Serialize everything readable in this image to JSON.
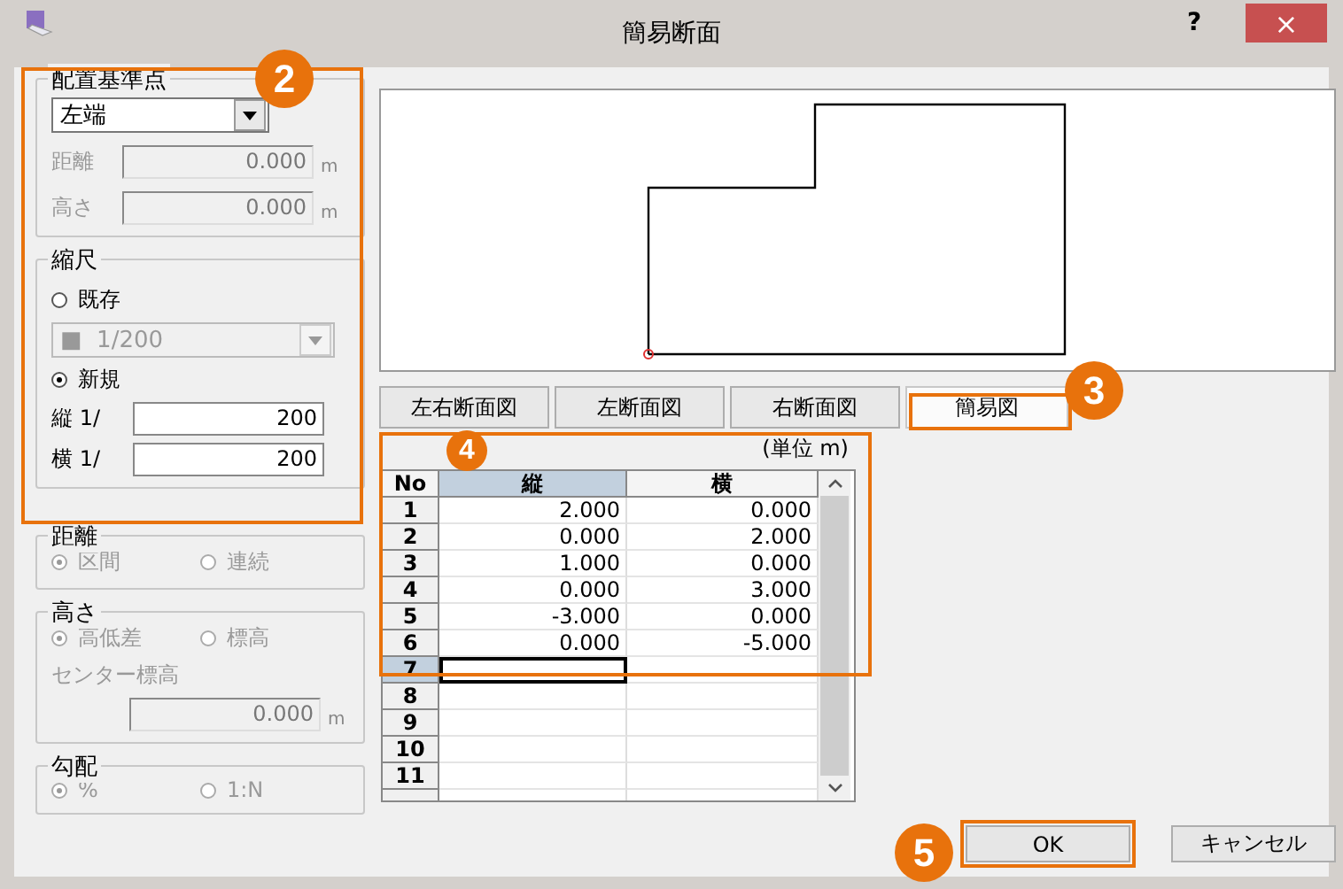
{
  "window": {
    "title": "簡易断面",
    "help": "?",
    "close": "×"
  },
  "placement": {
    "legend": "配置基準点",
    "dropdown": "左端",
    "fields": [
      {
        "label": "距離",
        "value": "0.000",
        "unit": "m",
        "disabled": true
      },
      {
        "label": "高さ",
        "value": "0.000",
        "unit": "m",
        "disabled": true
      }
    ]
  },
  "scale": {
    "legend": "縮尺",
    "options": [
      {
        "label": "既存",
        "selected": false
      },
      {
        "label": "新規",
        "selected": true
      }
    ],
    "dropdown": {
      "swatch": "■",
      "value": "1/200",
      "disabled": true
    },
    "fields": [
      {
        "label": "縦 1/",
        "value": "200"
      },
      {
        "label": "横 1/",
        "value": "200"
      }
    ]
  },
  "distance": {
    "legend": "距離",
    "disabled": true,
    "options": [
      {
        "label": "区間",
        "selected": true
      },
      {
        "label": "連続",
        "selected": false
      }
    ]
  },
  "height": {
    "legend": "高さ",
    "disabled": true,
    "options": [
      {
        "label": "高低差",
        "selected": true
      },
      {
        "label": "標高",
        "selected": false
      }
    ],
    "center_label": "センター標高",
    "center_value": "0.000",
    "unit": "m"
  },
  "slope": {
    "legend": "勾配",
    "disabled": true,
    "options": [
      {
        "label": "%",
        "selected": true
      },
      {
        "label": "1:N",
        "selected": false
      }
    ]
  },
  "view_tabs": [
    {
      "label": "左右断面図",
      "selected": false
    },
    {
      "label": "左断面図",
      "selected": false
    },
    {
      "label": "右断面図",
      "selected": false
    },
    {
      "label": "簡易図",
      "selected": true
    }
  ],
  "table": {
    "unit_label": "(単位 m)",
    "columns": [
      {
        "label": "No",
        "selected": false
      },
      {
        "label": "縦",
        "selected": true
      },
      {
        "label": "横",
        "selected": false
      }
    ],
    "rows": [
      {
        "no": "1",
        "vertical": "2.000",
        "horizontal": "0.000",
        "selected": false
      },
      {
        "no": "2",
        "vertical": "0.000",
        "horizontal": "2.000",
        "selected": false
      },
      {
        "no": "3",
        "vertical": "1.000",
        "horizontal": "0.000",
        "selected": false
      },
      {
        "no": "4",
        "vertical": "0.000",
        "horizontal": "3.000",
        "selected": false
      },
      {
        "no": "5",
        "vertical": "-3.000",
        "horizontal": "0.000",
        "selected": false
      },
      {
        "no": "6",
        "vertical": "0.000",
        "horizontal": "-5.000",
        "selected": false
      },
      {
        "no": "7",
        "selected": true
      },
      {
        "no": "8",
        "selected": false
      },
      {
        "no": "9",
        "selected": false
      },
      {
        "no": "10",
        "selected": false
      },
      {
        "no": "11",
        "selected": false
      }
    ]
  },
  "buttons": [
    {
      "label": "OK"
    },
    {
      "label": "キャンセル"
    }
  ],
  "annotations": [
    {
      "label": "2"
    },
    {
      "label": "3"
    },
    {
      "label": "4"
    },
    {
      "label": "5"
    }
  ]
}
